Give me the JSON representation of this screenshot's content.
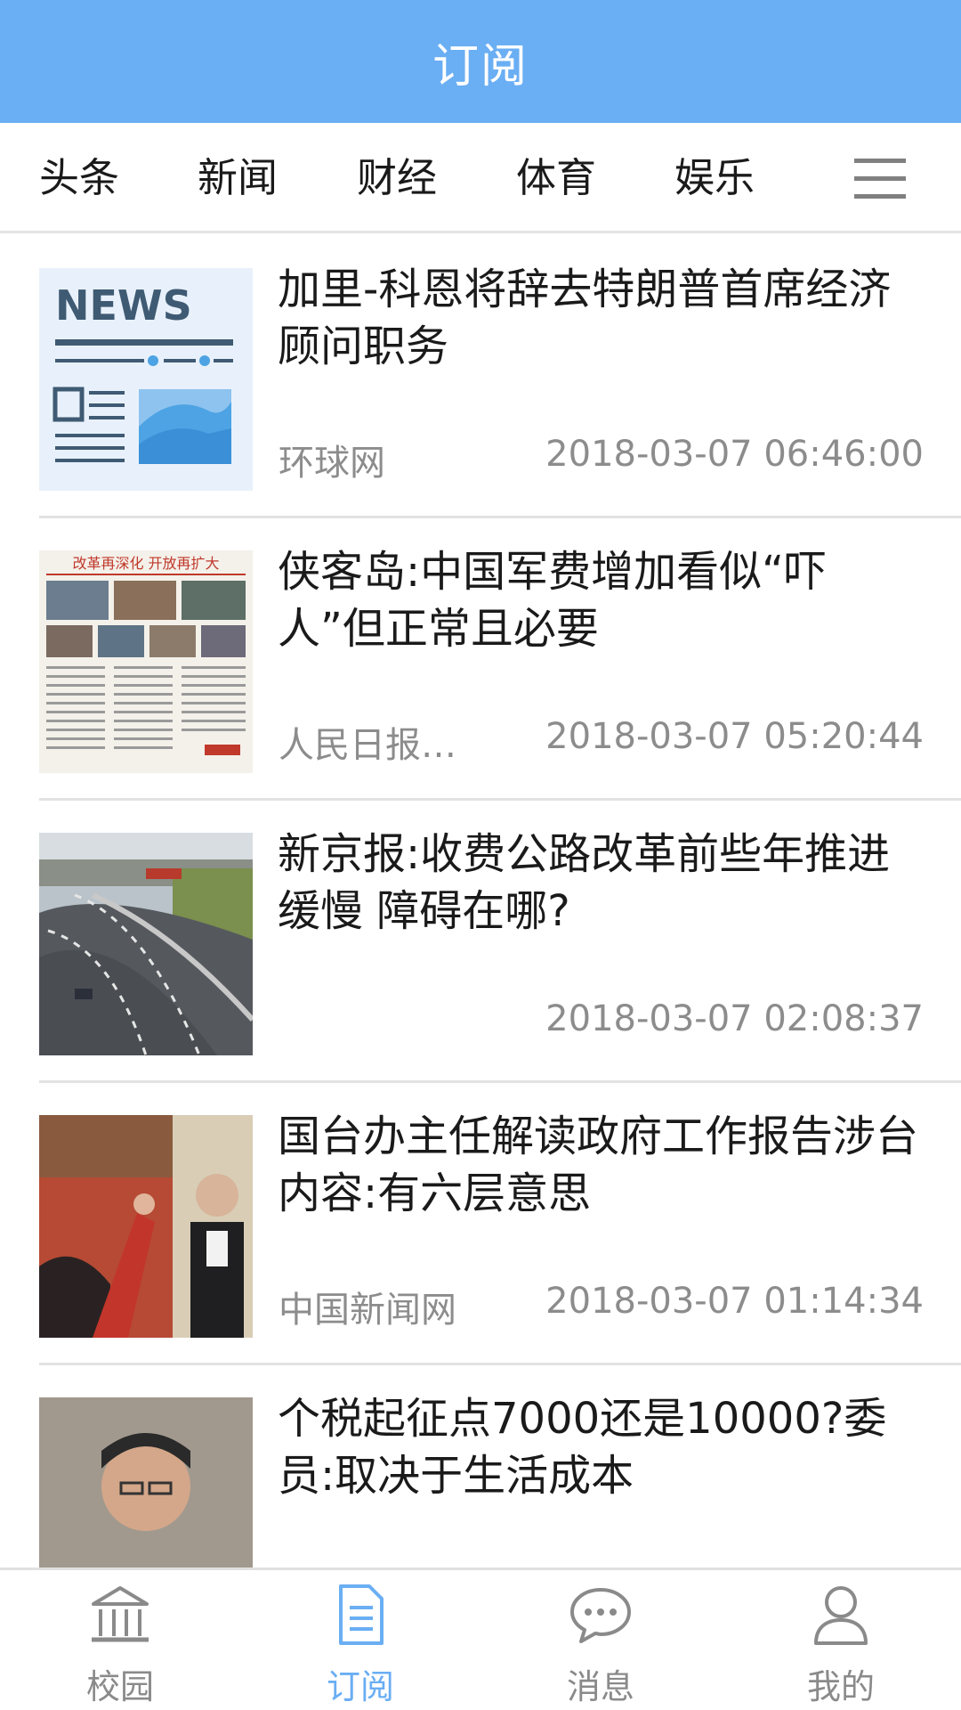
{
  "header": {
    "title": "订阅"
  },
  "tabs": [
    {
      "label": "头条"
    },
    {
      "label": "新闻"
    },
    {
      "label": "财经"
    },
    {
      "label": "体育"
    },
    {
      "label": "娱乐"
    }
  ],
  "menu_icon": "menu-icon",
  "news": [
    {
      "title": "加里-科恩将辞去特朗普首席经济顾问职务",
      "source": "环球网",
      "time": "2018-03-07 06:46:00",
      "thumb": "NEWS"
    },
    {
      "title": "侠客岛:中国军费增加看似“吓人”但正常且必要",
      "source": "人民日报…",
      "time": "2018-03-07 05:20:44",
      "thumb": "改革再深化 开放再扩大"
    },
    {
      "title": "新京报:收费公路改革前些年推进缓慢 障碍在哪?",
      "source": "",
      "time": "2018-03-07 02:08:37",
      "thumb": ""
    },
    {
      "title": "国台办主任解读政府工作报告涉台内容:有六层意思",
      "source": "中国新闻网",
      "time": "2018-03-07 01:14:34",
      "thumb": ""
    },
    {
      "title": "个税起征点7000还是10000?委员:取决于生活成本",
      "source": "",
      "time": "",
      "thumb": ""
    }
  ],
  "bottom_nav": [
    {
      "label": "校园",
      "icon": "building-icon",
      "active": false
    },
    {
      "label": "订阅",
      "icon": "document-icon",
      "active": true
    },
    {
      "label": "消息",
      "icon": "chat-bubble-icon",
      "active": false
    },
    {
      "label": "我的",
      "icon": "user-icon",
      "active": false
    }
  ],
  "colors": {
    "primary": "#6aaef3",
    "text": "#1a1a1a",
    "secondary_text": "#8c8c8c",
    "divider": "#e2e2e2"
  }
}
